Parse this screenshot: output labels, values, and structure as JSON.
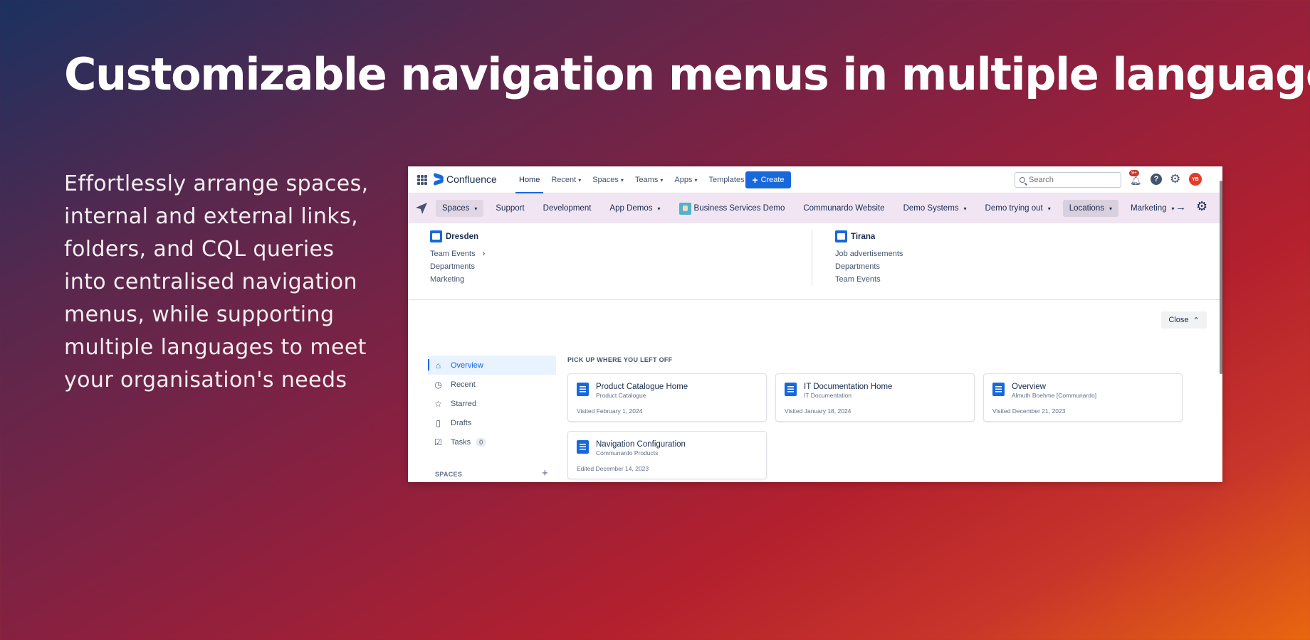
{
  "headline": "Customizable navigation menus in multiple languages",
  "description": "Effortlessly arrange spaces, internal and external links, folders, and CQL queries into centralised navigation menus, while supporting multiple languages to meet your organisation's needs",
  "app": {
    "topbar": {
      "product_name": "Confluence",
      "nav": [
        {
          "label": "Home",
          "active": true,
          "dropdown": false
        },
        {
          "label": "Recent",
          "dropdown": true
        },
        {
          "label": "Spaces",
          "dropdown": true
        },
        {
          "label": "Teams",
          "dropdown": true
        },
        {
          "label": "Apps",
          "dropdown": true
        },
        {
          "label": "Templates",
          "dropdown": false
        }
      ],
      "create_label": "Create",
      "search_placeholder": "Search",
      "notification_badge": "9+",
      "avatar_initials": "YB",
      "colors": {
        "accent": "#1868db",
        "avatar": "#e13b2a",
        "badge": "#c9372c"
      }
    },
    "menubar": {
      "background": "#f1e5f4",
      "items": [
        {
          "label": "Spaces",
          "dropdown": true
        },
        {
          "label": "Support",
          "dropdown": false
        },
        {
          "label": "Development",
          "dropdown": false
        },
        {
          "label": "App Demos",
          "dropdown": true
        },
        {
          "label": "Business Services Demo",
          "dropdown": false
        },
        {
          "label": "Communardo Website",
          "dropdown": false
        },
        {
          "label": "Demo Systems",
          "dropdown": true
        },
        {
          "label": "Demo trying out",
          "dropdown": true
        },
        {
          "label": "Locations",
          "dropdown": true,
          "selected": true
        },
        {
          "label": "Marketing",
          "dropdown": true
        }
      ]
    },
    "dropdown": {
      "columns": [
        {
          "title": "Dresden",
          "links": [
            "Team Events",
            "Departments",
            "Marketing"
          ]
        },
        {
          "title": "Tirana",
          "links": [
            "Job advertisements",
            "Departments",
            "Team Events"
          ]
        }
      ],
      "close_label": "Close"
    },
    "sidebar": {
      "items": [
        {
          "label": "Overview",
          "icon": "home-icon",
          "active": true
        },
        {
          "label": "Recent",
          "icon": "clock-icon"
        },
        {
          "label": "Starred",
          "icon": "star-icon"
        },
        {
          "label": "Drafts",
          "icon": "page-icon"
        },
        {
          "label": "Tasks",
          "icon": "checkbox-icon",
          "count": "0"
        }
      ],
      "spaces_header": "SPACES"
    },
    "main": {
      "section_title": "PICK UP WHERE YOU LEFT OFF",
      "cards": [
        {
          "title": "Product Catalogue Home",
          "subtitle": "Product Catalogue",
          "meta": "Visited February 1, 2024"
        },
        {
          "title": "IT Documentation Home",
          "subtitle": "IT Documentation",
          "meta": "Visited January 18, 2024"
        },
        {
          "title": "Overview",
          "subtitle": "Almuth Boehme [Communardo]",
          "meta": "Visited December 21, 2023"
        },
        {
          "title": "Navigation Configuration",
          "subtitle": "Communardo Products",
          "meta": "Edited December 14, 2023"
        }
      ]
    }
  }
}
